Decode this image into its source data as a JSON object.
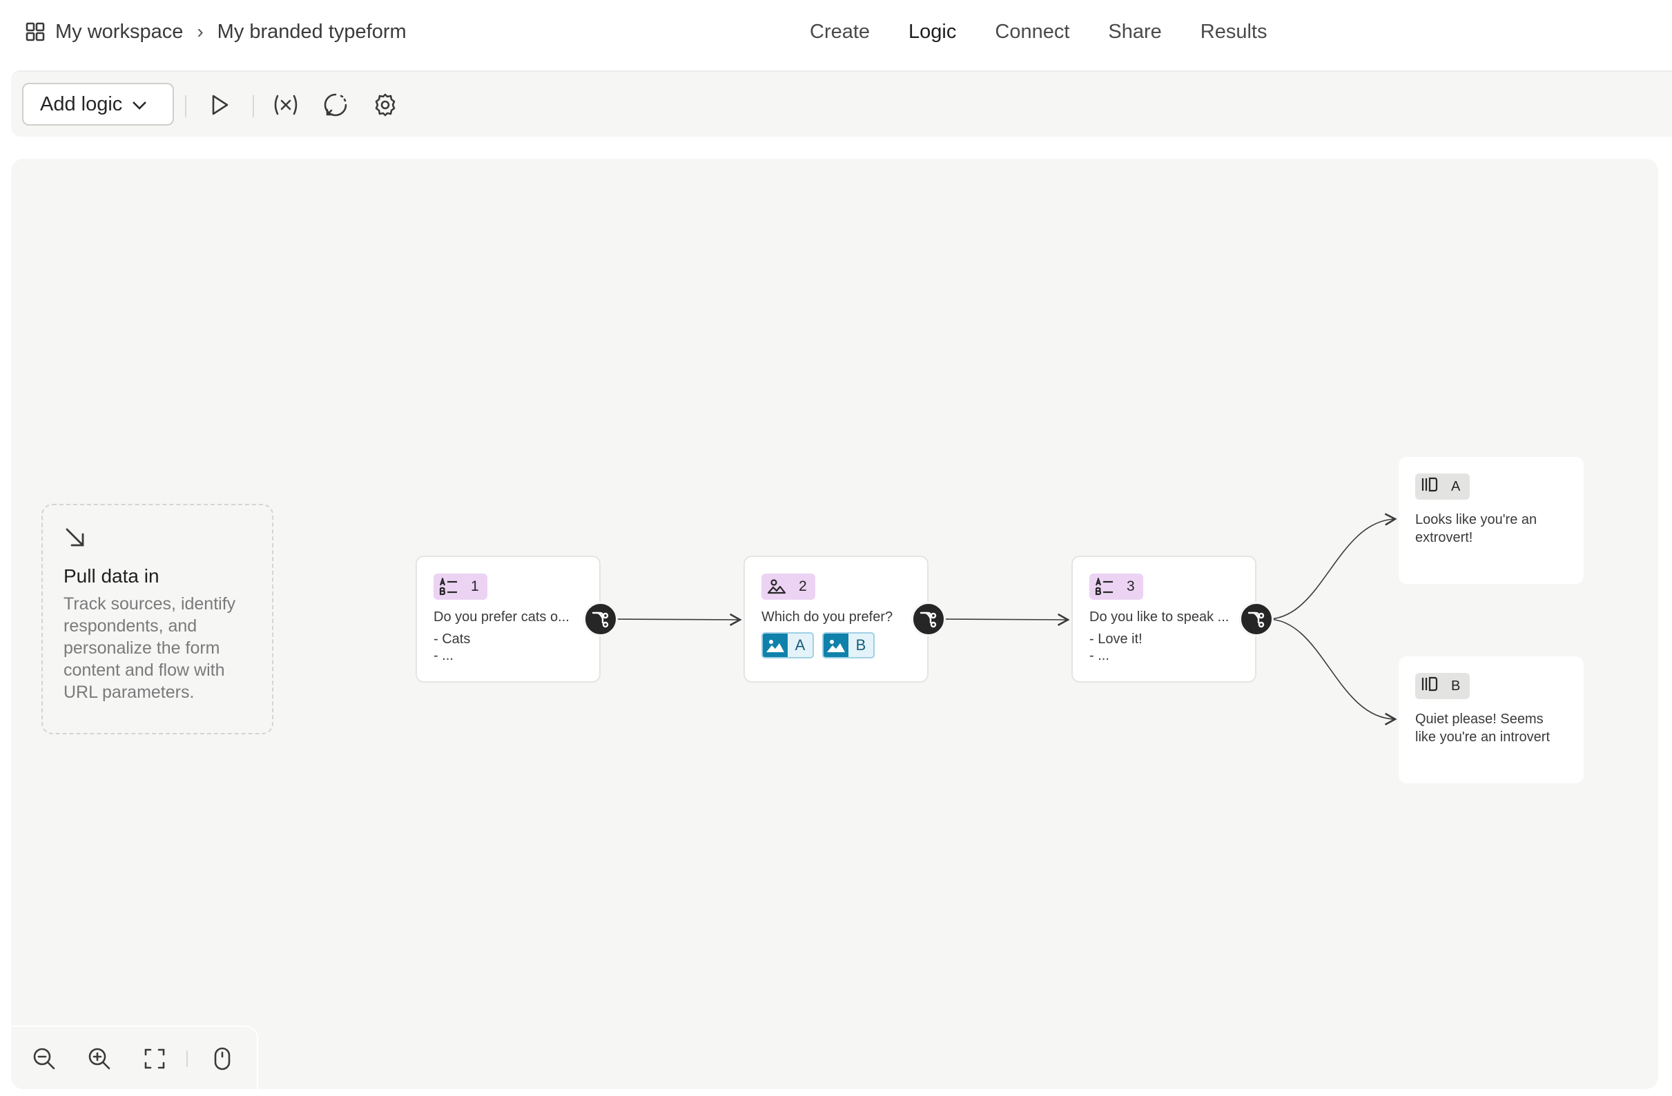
{
  "header": {
    "workspace": "My workspace",
    "form_name": "My branded typeform",
    "tabs": [
      {
        "label": "Create"
      },
      {
        "label": "Logic",
        "active": true
      },
      {
        "label": "Connect"
      },
      {
        "label": "Share"
      },
      {
        "label": "Results"
      }
    ]
  },
  "toolbar": {
    "add_logic_label": "Add logic",
    "icons": [
      "play-icon",
      "variable-icon",
      "logic-loop-icon",
      "settings-gear-icon"
    ]
  },
  "canvas": {
    "pull_card": {
      "title": "Pull data in",
      "description": "Track sources, identify respondents, and personalize the form content and flow with URL parameters."
    },
    "questions": [
      {
        "number": "1",
        "text": "Do you prefer cats o...",
        "choices": [
          "- Cats",
          "- ..."
        ],
        "type_icon": "multiple-choice-icon"
      },
      {
        "number": "2",
        "text": "Which do you prefer?",
        "picture_choices": [
          "A",
          "B"
        ],
        "type_icon": "picture-choice-icon"
      },
      {
        "number": "3",
        "text": "Do you like to speak ...",
        "choices": [
          "- Love it!",
          "- ..."
        ],
        "type_icon": "multiple-choice-icon"
      }
    ],
    "endings": [
      {
        "letter": "A",
        "text": "Looks like you're an extrovert!"
      },
      {
        "letter": "B",
        "text": "Quiet please! Seems like you're an introvert"
      }
    ]
  },
  "colors": {
    "canvas_bg": "#f6f6f4",
    "question_badge": "#ecd3f3",
    "ending_badge": "#e3e3e1",
    "picture_blue": "#0f81aa",
    "branch_button": "#262627"
  }
}
